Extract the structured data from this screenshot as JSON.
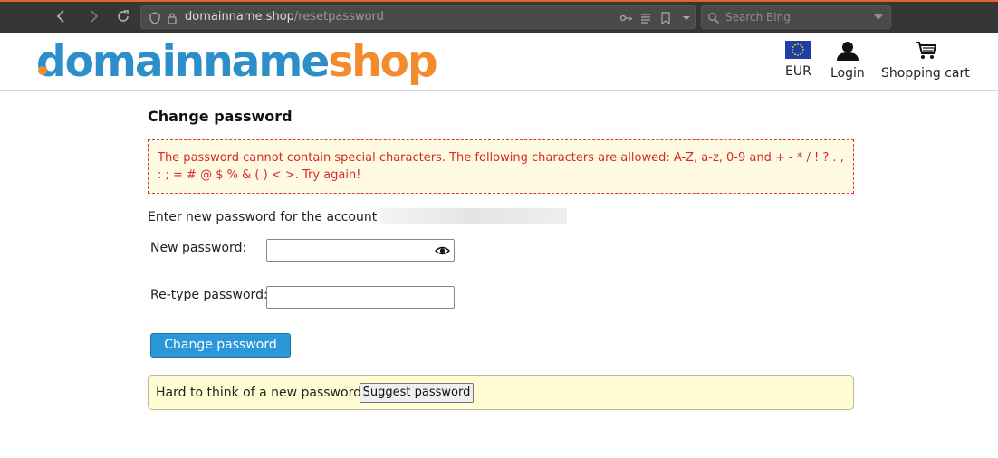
{
  "browser": {
    "url_domain": "domainname.shop",
    "url_path": "/resetpassword",
    "search_placeholder": "Search Bing"
  },
  "header": {
    "logo_part1": "domainname",
    "logo_part2": "shop",
    "currency_label": "EUR",
    "login_label": "Login",
    "cart_label": "Shopping cart",
    "brand_colors": {
      "blue": "#2d8fc9",
      "orange": "#f38b2c"
    }
  },
  "page": {
    "title": "Change password",
    "error_message": "The password cannot contain special characters. The following characters are allowed: A-Z, a-z, 0-9 and + - * / ! ? . , : ; = # @ $ % & ( ) < >. Try again!",
    "account_prompt": "Enter new password for the account",
    "new_password_label": "New password:",
    "new_password_value": "",
    "retype_password_label": "Re-type password:",
    "retype_password_value": "",
    "submit_label": "Change password",
    "suggest_prompt": "Hard to think of a new password?",
    "suggest_button_label": "Suggest password"
  },
  "icons": [
    "back-icon",
    "forward-icon",
    "reload-icon",
    "shield-icon",
    "lock-icon",
    "key-icon",
    "reader-icon",
    "bookmark-icon",
    "chevron-down-icon",
    "search-icon",
    "eu-flag-icon",
    "user-icon",
    "cart-icon",
    "eye-icon"
  ]
}
